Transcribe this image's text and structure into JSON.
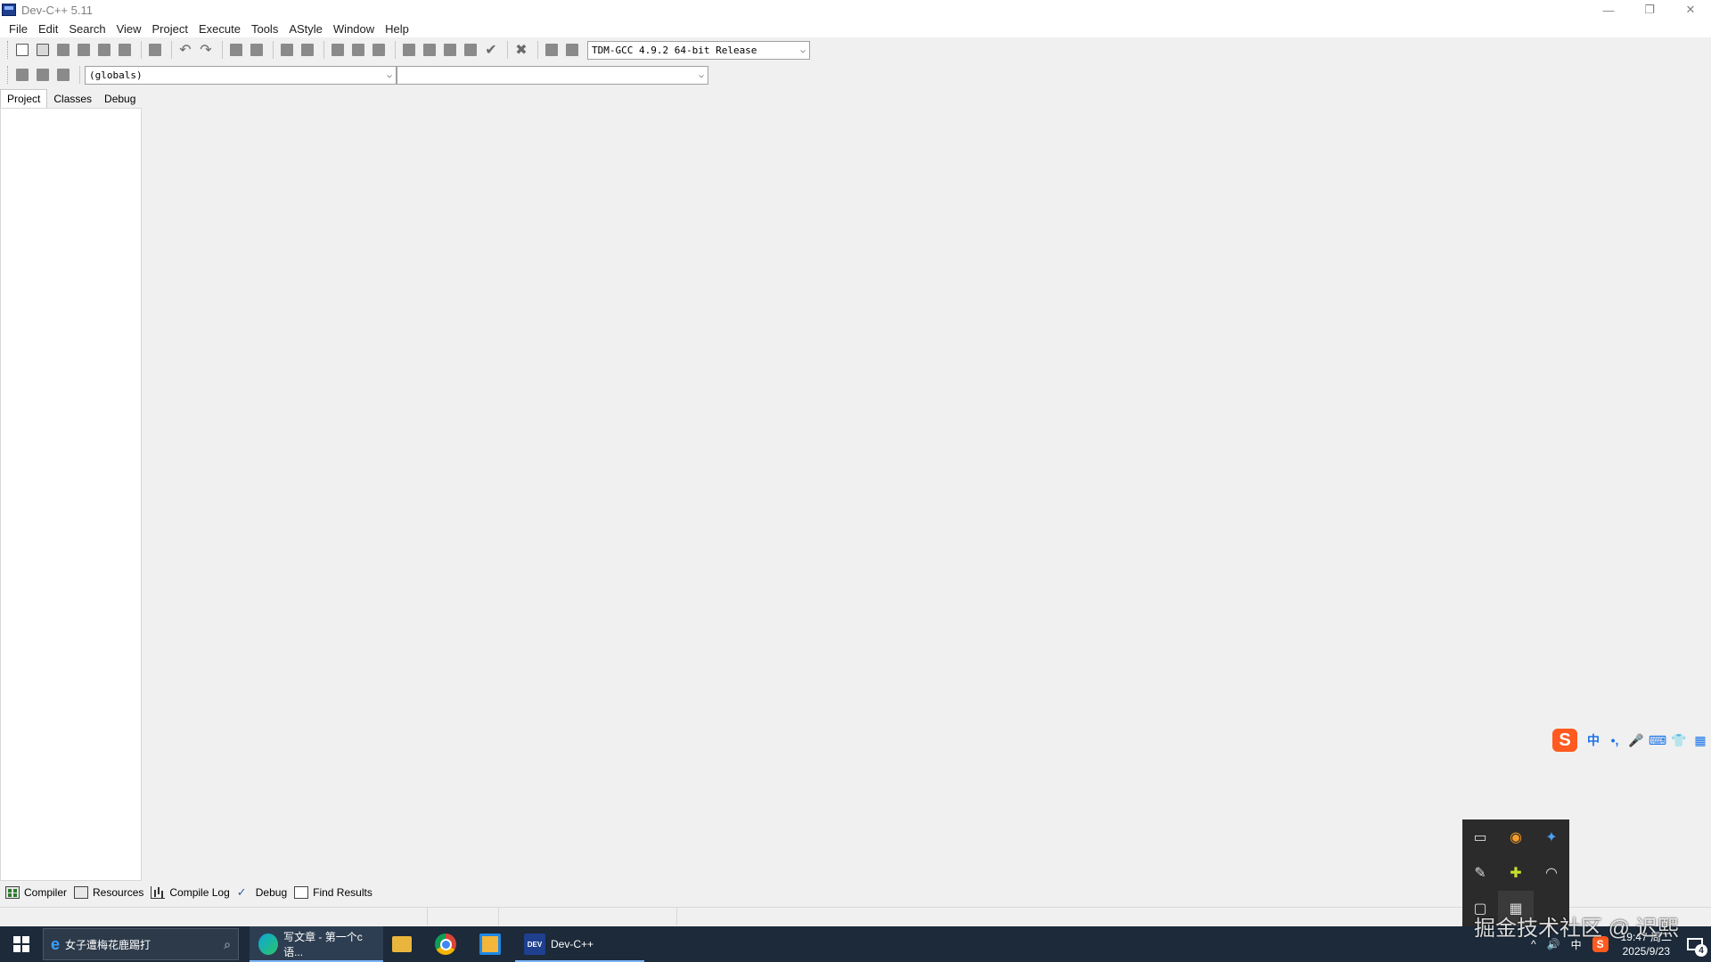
{
  "window": {
    "title": "Dev-C++ 5.11",
    "minimize": "—",
    "restore": "❐",
    "close": "✕"
  },
  "menu": [
    "File",
    "Edit",
    "Search",
    "View",
    "Project",
    "Execute",
    "Tools",
    "AStyle",
    "Window",
    "Help"
  ],
  "toolbar": {
    "compiler": "TDM-GCC 4.9.2 64-bit Release",
    "globals_combo": "(globals)",
    "member_combo": ""
  },
  "left_tabs": [
    "Project",
    "Classes",
    "Debug"
  ],
  "bottom_tabs": [
    "Compiler",
    "Resources",
    "Compile Log",
    "Debug",
    "Find Results"
  ],
  "ime": {
    "logo": "S",
    "lang": "中",
    "punct": "•,",
    "mic": "🎤",
    "keyboard": "⌨",
    "skin": "👕",
    "grid": "▦"
  },
  "taskbar": {
    "search_text": "女子遭梅花鹿踢打",
    "edge_task": "写文章 - 第一个c语...",
    "devcpp_task": "Dev-C++",
    "tray_chevron": "^",
    "volume": "🔊",
    "ime_lang": "中",
    "time": "19:47 周二",
    "date": "2025/9/23",
    "notifications": "4"
  },
  "watermark": "掘金技术社区 @ 迟熙"
}
